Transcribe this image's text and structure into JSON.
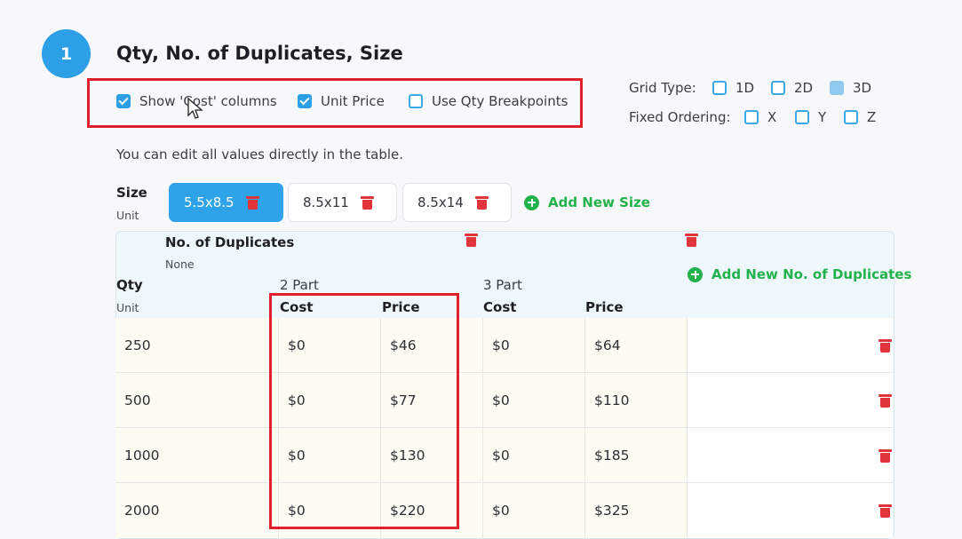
{
  "step": {
    "number": "1",
    "title": "Qty, No. of Duplicates, Size"
  },
  "options": {
    "show_cost": {
      "label": "Show 'Cost' columns",
      "checked": true
    },
    "unit_price": {
      "label": "Unit Price",
      "checked": true
    },
    "qty_breakpoints": {
      "label": "Use Qty Breakpoints",
      "checked": false
    }
  },
  "grid_type": {
    "label": "Grid Type:",
    "options": [
      {
        "label": "1D",
        "checked": false
      },
      {
        "label": "2D",
        "checked": false
      },
      {
        "label": "3D",
        "checked": true
      }
    ]
  },
  "fixed_ordering": {
    "label": "Fixed Ordering:",
    "options": [
      {
        "label": "X",
        "checked": false
      },
      {
        "label": "Y",
        "checked": false
      },
      {
        "label": "Z",
        "checked": false
      }
    ]
  },
  "hint": "You can edit all values directly in the table.",
  "size": {
    "label": "Size",
    "unit": "Unit",
    "tabs": [
      {
        "label": "5.5x8.5",
        "active": true
      },
      {
        "label": "8.5x11",
        "active": false
      },
      {
        "label": "8.5x14",
        "active": false
      }
    ],
    "add_label": "Add New Size"
  },
  "table": {
    "dup_label": "No. of Duplicates",
    "dup_unit": "None",
    "qty_label": "Qty",
    "qty_unit": "Unit",
    "add_dup_label": "Add New No. of Duplicates",
    "groups": [
      {
        "name": "2 Part",
        "cost_header": "Cost",
        "price_header": "Price"
      },
      {
        "name": "3 Part",
        "cost_header": "Cost",
        "price_header": "Price"
      }
    ],
    "rows": [
      {
        "qty": "250",
        "c1": "$0",
        "p1": "$46",
        "c2": "$0",
        "p2": "$64"
      },
      {
        "qty": "500",
        "c1": "$0",
        "p1": "$77",
        "c2": "$0",
        "p2": "$110"
      },
      {
        "qty": "1000",
        "c1": "$0",
        "p1": "$130",
        "c2": "$0",
        "p2": "$185"
      },
      {
        "qty": "2000",
        "c1": "$0",
        "p1": "$220",
        "c2": "$0",
        "p2": "$325"
      }
    ]
  },
  "colors": {
    "accent": "#2d9fe6",
    "green": "#22b24c",
    "danger": "#e2353b",
    "highlight": "#e0202a"
  }
}
